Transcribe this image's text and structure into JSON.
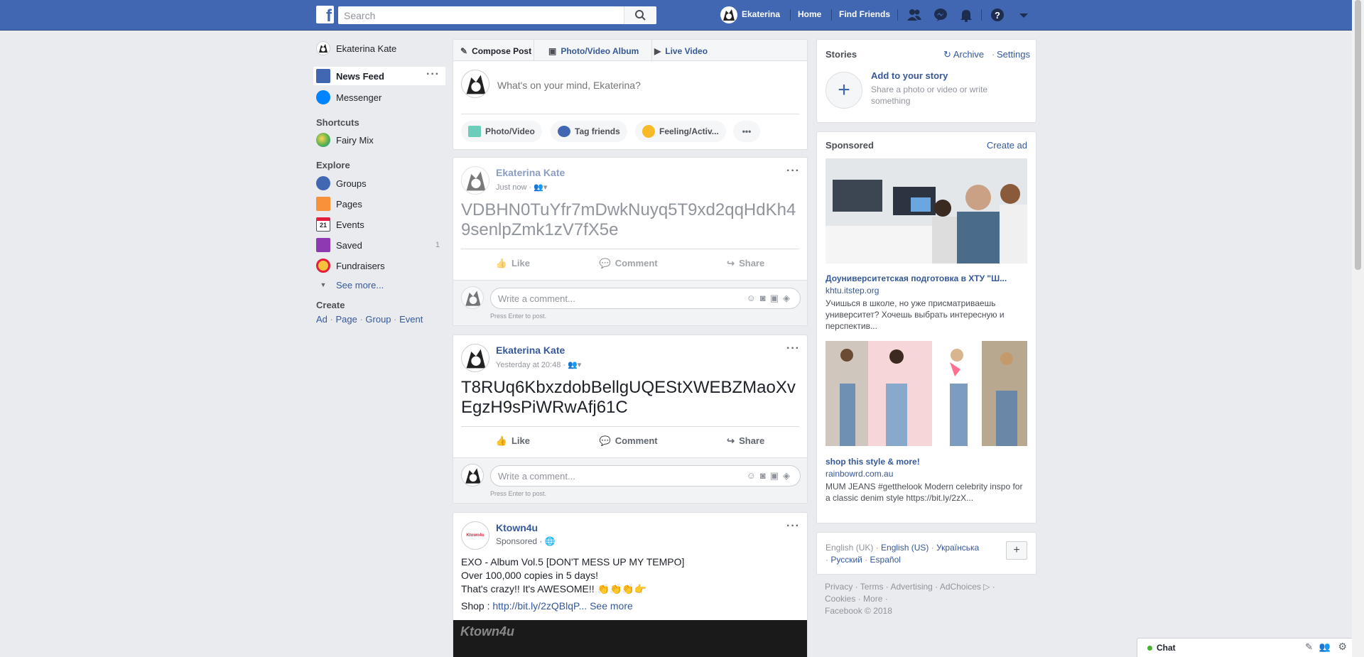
{
  "colors": {
    "brand": "#4267b2",
    "link": "#365899",
    "background": "#e9ebee"
  },
  "topbar": {
    "search_placeholder": "Search",
    "user_name": "Ekaterina",
    "home": "Home",
    "find_friends": "Find Friends"
  },
  "left_nav": {
    "profile_name": "Ekaterina Kate",
    "items": [
      {
        "label": "News Feed",
        "icon": "news-feed-icon"
      },
      {
        "label": "Messenger",
        "icon": "messenger-icon"
      }
    ],
    "shortcuts_heading": "Shortcuts",
    "shortcuts": [
      {
        "label": "Fairy Mix",
        "icon": "game-icon"
      }
    ],
    "explore_heading": "Explore",
    "explore": [
      {
        "label": "Groups",
        "icon": "groups-icon",
        "count": ""
      },
      {
        "label": "Pages",
        "icon": "pages-flag-icon",
        "count": ""
      },
      {
        "label": "Events",
        "icon": "calendar-icon",
        "count": ""
      },
      {
        "label": "Saved",
        "icon": "bookmark-icon",
        "count": "1"
      },
      {
        "label": "Fundraisers",
        "icon": "heart-icon",
        "count": ""
      }
    ],
    "see_more": "See more...",
    "create_heading": "Create",
    "create_links": [
      "Ad",
      "Page",
      "Group",
      "Event"
    ],
    "calendar_day": "21"
  },
  "composer": {
    "tabs": [
      "Compose Post",
      "Photo/Video Album",
      "Live Video"
    ],
    "placeholder": "What's on your mind, Ekaterina?",
    "buttons": [
      "Photo/Video",
      "Tag friends",
      "Feeling/Activ..."
    ]
  },
  "posts": [
    {
      "author": "Ekaterina Kate",
      "time": "Just now · ",
      "text": "VDBHN0TuYfr7mDwkNuyq5T9xd2qqHdKh4 9senlpZmk1zV7fX5e",
      "actions": [
        "Like",
        "Comment",
        "Share"
      ],
      "comment_placeholder": "Write a comment...",
      "hint": "Press Enter to post."
    },
    {
      "author": "Ekaterina Kate",
      "time": "Yesterday at 20:48 · ",
      "text": "T8RUq6KbxzdobBellgUQEStXWEBZMaoXv EgzH9sPiWRwAfj61C",
      "actions": [
        "Like",
        "Comment",
        "Share"
      ],
      "comment_placeholder": "Write a comment...",
      "hint": "Press Enter to post."
    }
  ],
  "sponsored_post": {
    "author": "Ktown4u",
    "label": "Sponsored · ",
    "lines": [
      "EXO - Album Vol.5 [DON'T MESS UP MY TEMPO]",
      "Over 100,000 copies in 5 days!",
      "That's crazy!! It's AWESOME!! 👏👏👏👉"
    ],
    "shop_label": "Shop : ",
    "shop_link": "http://bit.ly/2zQBlqP...",
    "see_more": "See more",
    "logo_text": "Ktown4u"
  },
  "stories": {
    "title": "Stories",
    "archive": "Archive",
    "settings": "Settings",
    "add": "Add to your story",
    "add_sub": "Share a photo or video or write something"
  },
  "sponsored": {
    "title": "Sponsored",
    "create_ad": "Create ad",
    "ads": [
      {
        "title": "Доуниверситетская подготовка в ХТУ \"Ш...",
        "domain": "khtu.itstep.org",
        "desc": "Учишься в школе, но уже присматриваешь университет? Хочешь выбрать интересную и перспектив..."
      },
      {
        "title": "shop this style & more!",
        "domain": "rainbowrd.com.au",
        "desc": "MUM JEANS #getthelook Modern celebrity inspo for a classic denim style https://bit.ly/2zX..."
      }
    ]
  },
  "languages": {
    "current": "English (UK)",
    "others": [
      "English (US)",
      "Українська",
      "Русский",
      "Español"
    ]
  },
  "footer": {
    "links": [
      "Privacy",
      "Terms",
      "Advertising",
      "AdChoices",
      "Cookies",
      "More"
    ],
    "copyright": "Facebook © 2018"
  },
  "chat": {
    "label": "Chat"
  }
}
